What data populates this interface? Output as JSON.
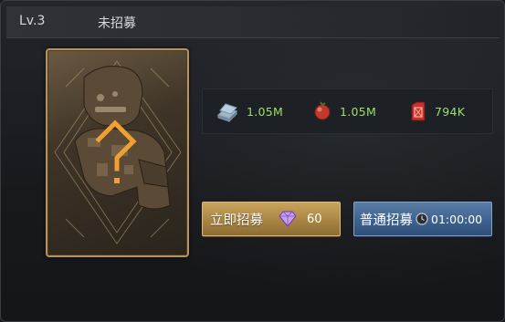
{
  "header": {
    "level": "Lv.3",
    "status": "未招募"
  },
  "card": {
    "portrait_icon": "soldier-silhouette-icon",
    "unknown_mark": "?",
    "frame_color": "#b7925a"
  },
  "resources": [
    {
      "icon": "steel-bars-icon",
      "value": "1.05M"
    },
    {
      "icon": "food-icon",
      "value": "1.05M"
    },
    {
      "icon": "fuel-can-icon",
      "value": "794K"
    }
  ],
  "buttons": {
    "instant": {
      "label": "立即招募",
      "icon": "diamond-icon",
      "cost": "60"
    },
    "normal": {
      "label": "普通招募",
      "icon": "clock-icon",
      "time": "01:00:00"
    }
  },
  "colors": {
    "resource_value": "#9be06a",
    "instant_button": "#b08b4a",
    "normal_button": "#4a6f9c",
    "question_mark": "#f0a030"
  }
}
